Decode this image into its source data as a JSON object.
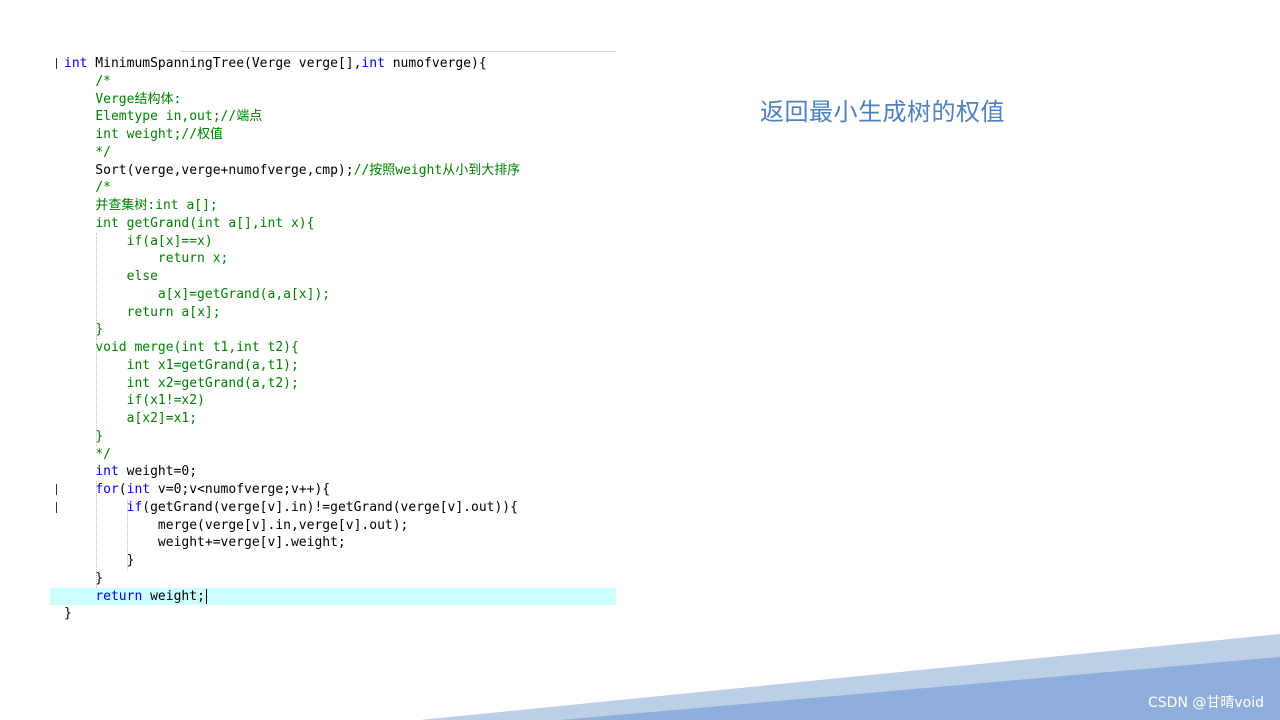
{
  "slide": {
    "title": "返回最小生成树的权值",
    "watermark": "CSDN @甘晴void"
  },
  "code": {
    "current_line": 31,
    "lines": [
      {
        "segments": [
          {
            "t": "int",
            "k": "keyword"
          },
          {
            "t": " MinimumSpanningTree(Verge verge[],"
          },
          {
            "t": "int",
            "k": "keyword"
          },
          {
            "t": " numofverge){"
          }
        ],
        "mark": true
      },
      {
        "segments": [
          {
            "t": "    "
          },
          {
            "t": "/*",
            "k": "comment"
          }
        ]
      },
      {
        "segments": [
          {
            "t": "    "
          },
          {
            "t": "Verge结构体:",
            "k": "comment"
          }
        ]
      },
      {
        "segments": [
          {
            "t": "    "
          },
          {
            "t": "Elemtype in,out;//端点",
            "k": "comment"
          }
        ]
      },
      {
        "segments": [
          {
            "t": "    "
          },
          {
            "t": "int weight;//权值",
            "k": "comment"
          }
        ]
      },
      {
        "segments": [
          {
            "t": "    "
          },
          {
            "t": "*/",
            "k": "comment"
          }
        ]
      },
      {
        "segments": [
          {
            "t": "    Sort(verge,verge+numofverge,cmp);"
          },
          {
            "t": "//按照weight从小到大排序",
            "k": "comment"
          }
        ]
      },
      {
        "segments": [
          {
            "t": "    "
          },
          {
            "t": "/*",
            "k": "comment"
          }
        ]
      },
      {
        "segments": [
          {
            "t": "    "
          },
          {
            "t": "并查集树:int a[];",
            "k": "comment"
          }
        ]
      },
      {
        "segments": [
          {
            "t": "    "
          },
          {
            "t": "int getGrand(int a[],int x){",
            "k": "comment"
          }
        ]
      },
      {
        "segments": [
          {
            "t": "        "
          },
          {
            "t": "if(a[x]==x)",
            "k": "comment"
          }
        ]
      },
      {
        "segments": [
          {
            "t": "            "
          },
          {
            "t": "return x;",
            "k": "comment"
          }
        ]
      },
      {
        "segments": [
          {
            "t": "        "
          },
          {
            "t": "else",
            "k": "comment"
          }
        ]
      },
      {
        "segments": [
          {
            "t": "            "
          },
          {
            "t": "a[x]=getGrand(a,a[x]);",
            "k": "comment"
          }
        ]
      },
      {
        "segments": [
          {
            "t": "        "
          },
          {
            "t": "return a[x];",
            "k": "comment"
          }
        ]
      },
      {
        "segments": [
          {
            "t": "    "
          },
          {
            "t": "}",
            "k": "comment"
          }
        ]
      },
      {
        "segments": [
          {
            "t": "    "
          },
          {
            "t": "void merge(int t1,int t2){",
            "k": "comment"
          }
        ]
      },
      {
        "segments": [
          {
            "t": "        "
          },
          {
            "t": "int x1=getGrand(a,t1);",
            "k": "comment"
          }
        ]
      },
      {
        "segments": [
          {
            "t": "        "
          },
          {
            "t": "int x2=getGrand(a,t2);",
            "k": "comment"
          }
        ]
      },
      {
        "segments": [
          {
            "t": "        "
          },
          {
            "t": "if(x1!=x2)",
            "k": "comment"
          }
        ]
      },
      {
        "segments": [
          {
            "t": "        "
          },
          {
            "t": "a[x2]=x1;",
            "k": "comment"
          }
        ]
      },
      {
        "segments": [
          {
            "t": "    "
          },
          {
            "t": "}",
            "k": "comment"
          }
        ]
      },
      {
        "segments": [
          {
            "t": "    "
          },
          {
            "t": "*/",
            "k": "comment"
          }
        ]
      },
      {
        "segments": [
          {
            "t": "    "
          },
          {
            "t": "int",
            "k": "keyword"
          },
          {
            "t": " weight=0;"
          }
        ]
      },
      {
        "segments": [
          {
            "t": "    "
          },
          {
            "t": "for",
            "k": "keyword"
          },
          {
            "t": "("
          },
          {
            "t": "int",
            "k": "keyword"
          },
          {
            "t": " v=0;v<numofverge;v++){"
          }
        ],
        "mark": true
      },
      {
        "segments": [
          {
            "t": "        "
          },
          {
            "t": "if",
            "k": "keyword"
          },
          {
            "t": "(getGrand(verge[v].in)!=getGrand(verge[v].out)){"
          }
        ],
        "mark": true
      },
      {
        "segments": [
          {
            "t": "            merge(verge[v].in,verge[v].out);"
          }
        ]
      },
      {
        "segments": [
          {
            "t": "            weight+=verge[v].weight;"
          }
        ]
      },
      {
        "segments": [
          {
            "t": "        }"
          }
        ]
      },
      {
        "segments": [
          {
            "t": "    }"
          }
        ]
      },
      {
        "segments": [
          {
            "t": "    "
          },
          {
            "t": "return",
            "k": "keyword"
          },
          {
            "t": " weight;"
          }
        ]
      },
      {
        "segments": [
          {
            "t": "}"
          }
        ]
      }
    ]
  }
}
